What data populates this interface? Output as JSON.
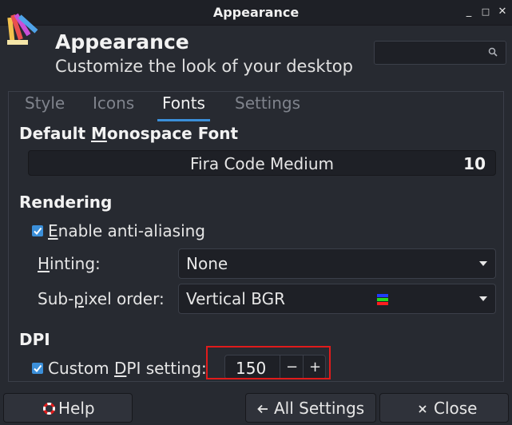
{
  "window": {
    "title": "Appearance",
    "buttons": {
      "minimize": "_",
      "maximize": "□",
      "close": "✕"
    }
  },
  "header": {
    "title": "Appearance",
    "subtitle": "Customize the look of your desktop",
    "search_placeholder": ""
  },
  "tabs": [
    {
      "label": "Style",
      "active": false
    },
    {
      "label": "Icons",
      "active": false
    },
    {
      "label": "Fonts",
      "active": true
    },
    {
      "label": "Settings",
      "active": false
    }
  ],
  "fonts": {
    "monospace_title_prefix": "Default ",
    "monospace_title_mnemonic": "M",
    "monospace_title_rest": "onospace Font",
    "monospace_font_name": "Fira Code Medium",
    "monospace_font_size": "10"
  },
  "rendering": {
    "title": "Rendering",
    "antialias_mnemonic": "E",
    "antialias_rest": "nable anti-aliasing",
    "antialias_checked": true,
    "hinting_mnemonic": "H",
    "hinting_rest": "inting:",
    "hinting_value": "None",
    "subpixel_pre": "Sub-",
    "subpixel_mnemonic": "p",
    "subpixel_rest": "ixel order:",
    "subpixel_value": "Vertical BGR",
    "subpixel_colors": [
      "#1e3cff",
      "#26d926",
      "#ff1e1e"
    ]
  },
  "dpi": {
    "title": "DPI",
    "custom_pre": "Custom ",
    "custom_mnemonic": "D",
    "custom_rest": "PI setting:",
    "custom_checked": true,
    "value": "150",
    "minus": "−",
    "plus": "+"
  },
  "footer": {
    "help_label": "Help",
    "all_settings_label": "All Settings",
    "close_label": "Close"
  },
  "colors": {
    "accent": "#3b8fd9",
    "highlight": "#e01b1b"
  }
}
